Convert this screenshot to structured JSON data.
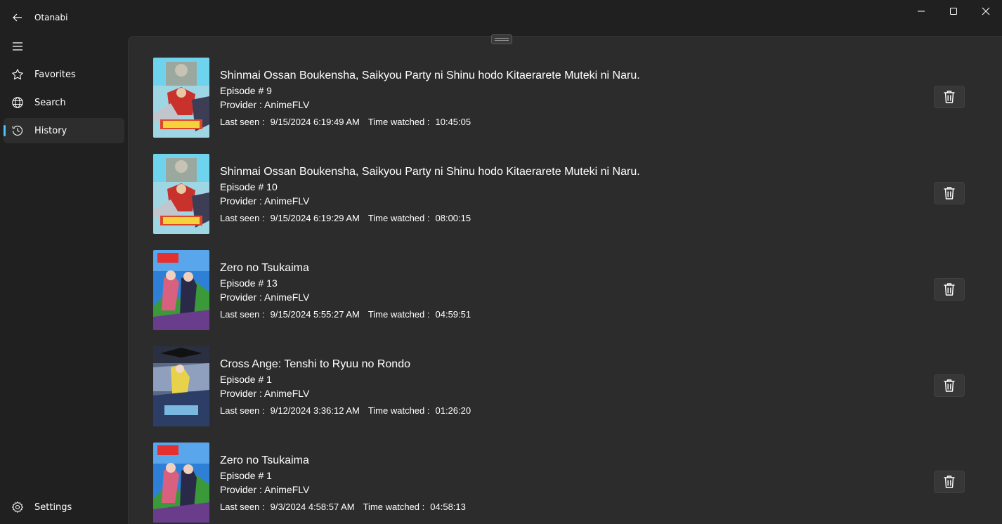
{
  "app": {
    "title": "Otanabi"
  },
  "window_controls": [
    "minimize-icon",
    "maximize-icon",
    "close-icon"
  ],
  "nav": {
    "items": [
      {
        "label": "Favorites",
        "icon": "star-icon"
      },
      {
        "label": "Search",
        "icon": "globe-icon"
      },
      {
        "label": "History",
        "icon": "history-icon",
        "selected": true
      }
    ],
    "settings": {
      "label": "Settings",
      "icon": "gear-icon"
    }
  },
  "history": {
    "labels": {
      "last_seen": "Last seen :",
      "time_watched": "Time watched :"
    },
    "entries": [
      {
        "title": "Shinmai Ossan Boukensha, Saikyou Party ni Shinu hodo Kitaerarete Muteki ni Naru.",
        "episode": "Episode # 9",
        "provider": "Provider : AnimeFLV",
        "last_seen": "9/15/2024 6:19:49 AM",
        "time_watched": "10:45:05"
      },
      {
        "title": "Shinmai Ossan Boukensha, Saikyou Party ni Shinu hodo Kitaerarete Muteki ni Naru.",
        "episode": "Episode # 10",
        "provider": "Provider : AnimeFLV",
        "last_seen": "9/15/2024 6:19:29 AM",
        "time_watched": "08:00:15"
      },
      {
        "title": "Zero no Tsukaima",
        "episode": "Episode # 13",
        "provider": "Provider : AnimeFLV",
        "last_seen": "9/15/2024 5:55:27 AM",
        "time_watched": "04:59:51"
      },
      {
        "title": "Cross Ange: Tenshi to Ryuu no Rondo",
        "episode": "Episode # 1",
        "provider": "Provider : AnimeFLV",
        "last_seen": "9/12/2024 3:36:12 AM",
        "time_watched": "01:26:20"
      },
      {
        "title": "Zero no Tsukaima",
        "episode": "Episode # 1",
        "provider": "Provider : AnimeFLV",
        "last_seen": "9/3/2024 4:58:57 AM",
        "time_watched": "04:58:13"
      }
    ]
  },
  "colors": {
    "accent": "#4cc2ff",
    "background": "#202020",
    "content": "#2c2c2c"
  }
}
